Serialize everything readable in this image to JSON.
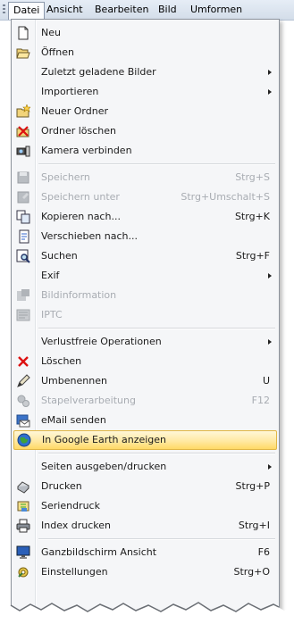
{
  "menubar": {
    "items": [
      {
        "label": "Datei",
        "active": true
      },
      {
        "label": "Ansicht"
      },
      {
        "label": "Bearbeiten"
      },
      {
        "label": "Bild"
      },
      {
        "label": "Umformen"
      }
    ]
  },
  "menu": {
    "items": [
      {
        "label": "Neu",
        "icon": "new-file-icon"
      },
      {
        "label": "Öffnen",
        "icon": "open-folder-icon"
      },
      {
        "label": "Zuletzt geladene Bilder",
        "submenu": true
      },
      {
        "label": "Importieren",
        "submenu": true
      },
      {
        "label": "Neuer Ordner",
        "icon": "new-folder-icon"
      },
      {
        "label": "Ordner löschen",
        "icon": "delete-folder-icon"
      },
      {
        "label": "Kamera verbinden",
        "icon": "camera-icon"
      },
      {
        "label": "Speichern",
        "shortcut": "Strg+S",
        "disabled": true,
        "icon": "save-icon"
      },
      {
        "label": "Speichern unter",
        "shortcut": "Strg+Umschalt+S",
        "disabled": true,
        "icon": "save-as-icon"
      },
      {
        "label": "Kopieren nach...",
        "shortcut": "Strg+K",
        "icon": "copy-to-icon"
      },
      {
        "label": "Verschieben nach...",
        "icon": "move-to-icon"
      },
      {
        "label": "Suchen",
        "shortcut": "Strg+F",
        "icon": "search-icon"
      },
      {
        "label": "Exif",
        "submenu": true
      },
      {
        "label": "Bildinformation",
        "disabled": true,
        "icon": "image-info-icon"
      },
      {
        "label": "IPTC",
        "disabled": true,
        "icon": "iptc-icon"
      },
      {
        "label": "Verlustfreie Operationen",
        "submenu": true
      },
      {
        "label": "Löschen",
        "icon": "delete-icon"
      },
      {
        "label": "Umbenennen",
        "shortcut": "U",
        "icon": "rename-icon"
      },
      {
        "label": "Stapelverarbeitung",
        "shortcut": "F12",
        "disabled": true,
        "icon": "batch-icon"
      },
      {
        "label": "eMail senden",
        "icon": "email-icon"
      },
      {
        "label": "In Google Earth anzeigen",
        "highlighted": true,
        "icon": "google-earth-icon"
      },
      {
        "label": "Seiten ausgeben/drucken",
        "submenu": true
      },
      {
        "label": "Drucken",
        "shortcut": "Strg+P",
        "icon": "print-icon"
      },
      {
        "label": "Seriendruck",
        "icon": "batch-print-icon"
      },
      {
        "label": "Index drucken",
        "shortcut": "Strg+I",
        "icon": "index-print-icon"
      },
      {
        "label": "Ganzbildschirm Ansicht",
        "shortcut": "F6",
        "icon": "fullscreen-icon"
      },
      {
        "label": "Einstellungen",
        "shortcut": "Strg+O",
        "icon": "settings-icon"
      }
    ]
  },
  "colors": {
    "highlight": "#ffe9a3",
    "disabled_text": "#a8acb2",
    "menu_bg": "#f5f6f8"
  }
}
